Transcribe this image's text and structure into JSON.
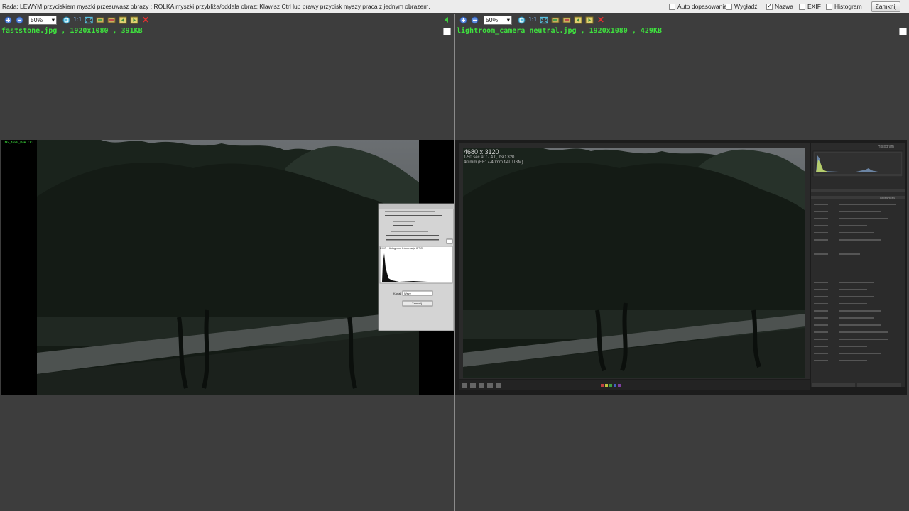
{
  "topbar": {
    "hint": "Rada: LEWYM przyciskiem myszki przesuwasz obrazy ; ROLKA myszki przybliża/oddala obraz; Klawisz Ctrl lub prawy przycisk myszy praca z jednym obrazem.",
    "options": [
      {
        "label": "Auto dopasowanie",
        "checked": false
      },
      {
        "label": "Wygładź",
        "checked": false
      },
      {
        "label": "Nazwa",
        "checked": true
      },
      {
        "label": "EXIF",
        "checked": false
      },
      {
        "label": "Histogram",
        "checked": false
      }
    ],
    "close_label": "Zamknij"
  },
  "left": {
    "zoom": "50%",
    "one_to_one": "1:1",
    "file_label": "faststone.jpg , 1920x1080 , 391KB",
    "dialog": {
      "tabs": [
        "EXIF",
        "Histogram",
        "Informacje IPTC"
      ],
      "channel_label": "Kanał",
      "channel_value": "Wszy",
      "button_label": "Zamknij"
    }
  },
  "right": {
    "zoom": "50%",
    "one_to_one": "1:1",
    "file_label": "lightroom_camera neutral.jpg , 1920x1080 , 429KB",
    "overlay_line1": "4680 x 3120",
    "overlay_line2": "1/50 sec at f / 4.0, ISO 320",
    "overlay_line3": "40 mm (EF17-40mm f/4L USM)",
    "panel_header": "Histogram",
    "metadata_header": "Metadata"
  },
  "colors": {
    "accent_green": "#3ee23e",
    "close_red": "#e23030",
    "background": "#3d3d3d"
  }
}
